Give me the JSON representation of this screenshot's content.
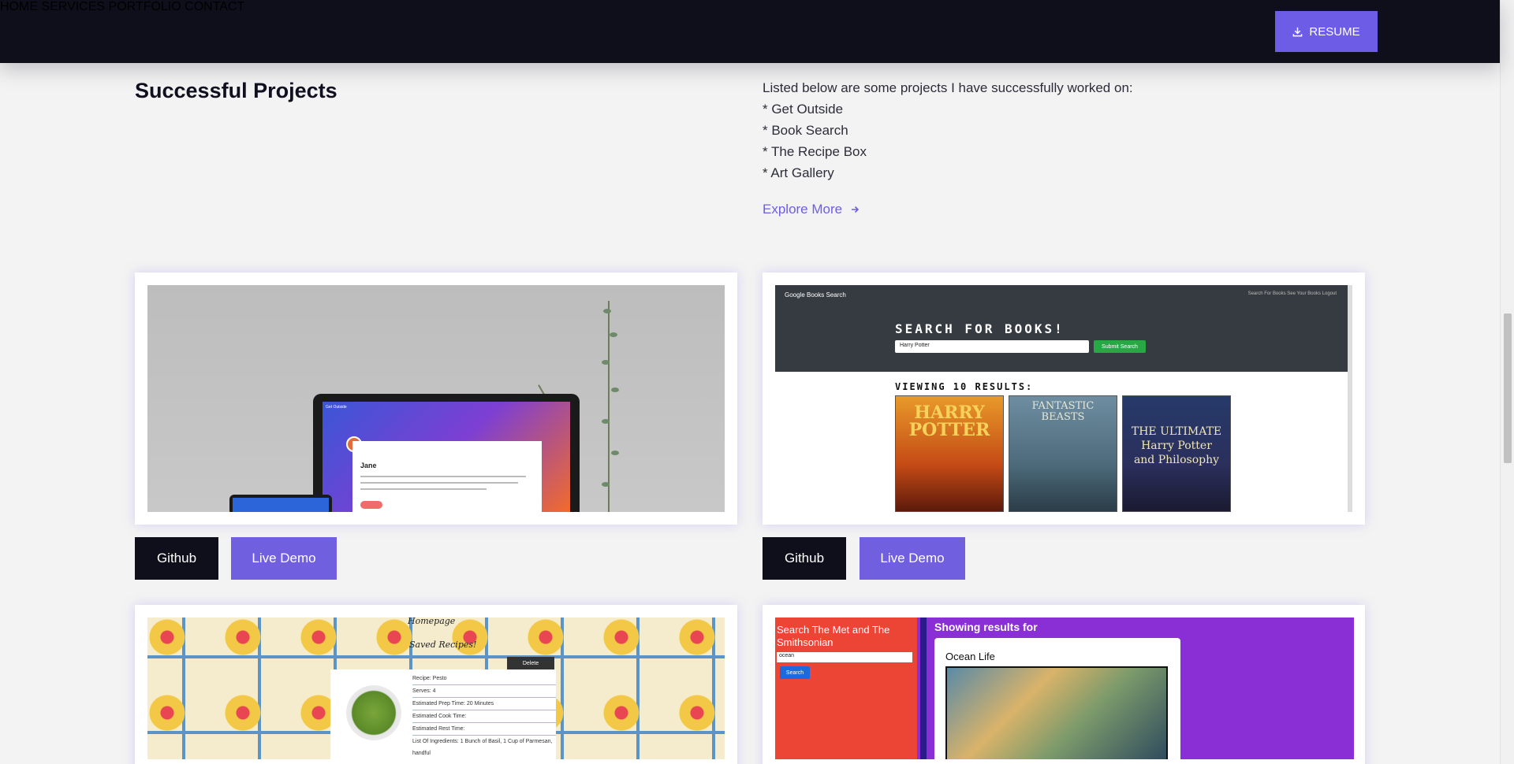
{
  "nav": {
    "home": "HOME",
    "services": "SERVICES",
    "portfolio": "PORTFOLIO",
    "contact": "CONTACT",
    "resume": "RESUME"
  },
  "section": {
    "title": "Successful Projects",
    "intro": "Listed below are some projects I have successfully worked on:",
    "projects": [
      "* Get Outside",
      "* Book Search",
      "* The Recipe Box",
      "* Art Gallery"
    ],
    "explore": "Explore More"
  },
  "cards": [
    {
      "github": "Github",
      "demo": "Live Demo"
    },
    {
      "github": "Github",
      "demo": "Live Demo"
    }
  ],
  "p1": {
    "app_name": "Get Outside",
    "user": "Jane"
  },
  "p2": {
    "brand": "Google Books Search",
    "links": "Search For Books   See Your Books   Logout",
    "title": "SEARCH FOR BOOKS!",
    "input_value": "Harry Potter",
    "submit": "Submit Search",
    "results": "VIEWING 10 RESULTS:",
    "book1": "HARRY POTTER",
    "book2": "FANTASTIC BEASTS",
    "book3": "THE ULTIMATE Harry Potter and Philosophy"
  },
  "p3": {
    "heading1": "Homepage",
    "heading2": "Saved Recipes!",
    "delete": "Delete",
    "lines": [
      "Recipe: Pesto",
      "Serves: 4",
      "Estimated Prep Time: 20 Minutes",
      "Estimated Cook Time:",
      "Estimated Rest Time:",
      "List Of Ingredients: 1 Bunch of Basil, 1 Cup of Parmesan, handful"
    ]
  },
  "p4": {
    "sidebar_title": "Search The Met and The Smithsonian",
    "input_value": "ocean",
    "search": "Search",
    "results": "Showing results for",
    "card_title": "Ocean Life"
  },
  "colors": {
    "header": "#0f0f1c",
    "accent": "#6d5de6",
    "background": "#f3f3f3"
  }
}
